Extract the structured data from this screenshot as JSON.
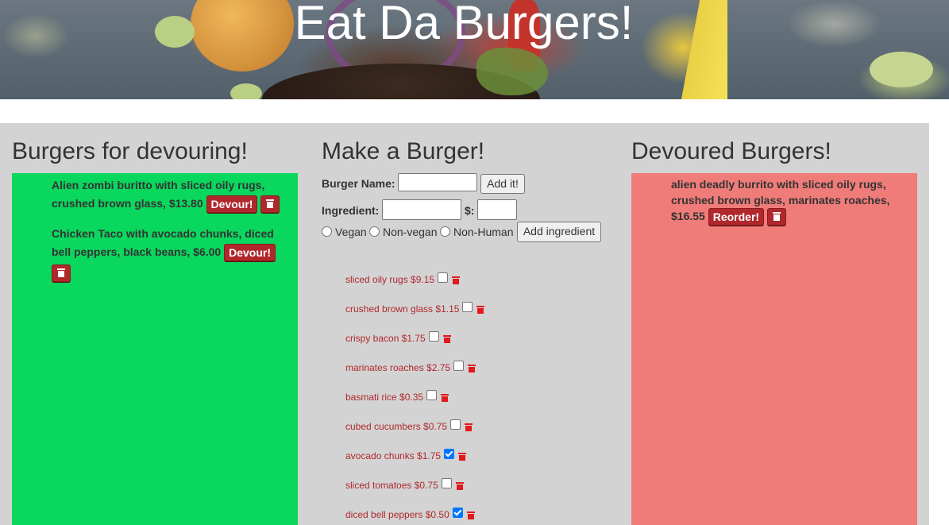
{
  "header": {
    "title": "Eat Da Burgers!"
  },
  "columns": {
    "devour_title": "Burgers for devouring!",
    "make_title": "Make a Burger!",
    "devoured_title": "Devoured Burgers!"
  },
  "to_devour": [
    {
      "line1": "Alien zombi buritto with sliced oily rugs,",
      "line2": "crushed brown glass, $13.80",
      "button": "Devour!"
    },
    {
      "line1": "Chicken Taco with avocado chunks, diced",
      "line2": "bell peppers, black beans, $6.00",
      "button": "Devour!"
    }
  ],
  "devoured": [
    {
      "line1": "alien deadly burrito with sliced oily rugs,",
      "line2": "crushed brown glass, marinates roaches,",
      "line3": "$16.55",
      "button": "Reorder!"
    }
  ],
  "form": {
    "burger_name_label": "Burger Name:",
    "burger_name_value": "",
    "add_button": "Add it!",
    "ingredient_label": "Ingredient:",
    "ingredient_value": "",
    "price_label": "$:",
    "price_value": "",
    "radio_options": [
      "Vegan",
      "Non-vegan",
      "Non-Human"
    ],
    "add_ingredient_button": "Add ingredient"
  },
  "ingredients": [
    {
      "label": "sliced oily rugs $9.15",
      "checked": false
    },
    {
      "label": "crushed brown glass $1.15",
      "checked": false
    },
    {
      "label": "crispy bacon $1.75",
      "checked": false
    },
    {
      "label": "marinates roaches $2.75",
      "checked": false
    },
    {
      "label": "basmati rice $0.35",
      "checked": false
    },
    {
      "label": "cubed cucumbers $0.75",
      "checked": false
    },
    {
      "label": "avocado chunks $1.75",
      "checked": true
    },
    {
      "label": "sliced tomatoes $0.75",
      "checked": false
    },
    {
      "label": "diced bell peppers $0.50",
      "checked": true
    }
  ]
}
